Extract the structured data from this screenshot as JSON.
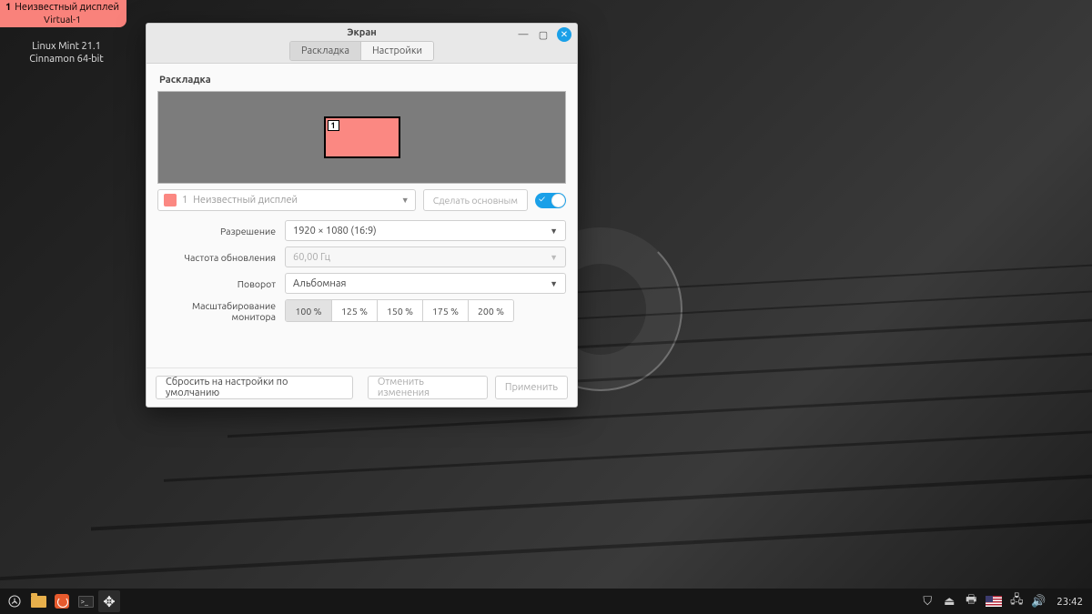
{
  "badge": {
    "num": "1",
    "title": "Неизвестный дисплей",
    "sub": "Virtual-1"
  },
  "distro": {
    "line1": "Linux Mint 21.1",
    "line2": "Cinnamon 64-bit"
  },
  "window": {
    "title": "Экран",
    "tabs": {
      "layout": "Раскладка",
      "settings": "Настройки"
    },
    "section_layout": "Раскладка",
    "monitor_num": "1",
    "display_selector": {
      "num": "1",
      "name": "Неизвестный дисплей"
    },
    "make_primary": "Сделать основным",
    "labels": {
      "resolution": "Разрешение",
      "refresh": "Частота обновления",
      "rotation": "Поворот",
      "scale": "Масштабирование монитора"
    },
    "values": {
      "resolution": "1920 × 1080 (16:9)",
      "refresh": "60,00 Гц",
      "rotation": "Альбомная"
    },
    "scales": [
      "100 %",
      "125 %",
      "150 %",
      "175 %",
      "200 %"
    ],
    "footer": {
      "reset": "Сбросить на настройки по умолчанию",
      "cancel": "Отменить изменения",
      "apply": "Применить"
    }
  },
  "taskbar": {
    "clock": "23:42"
  }
}
